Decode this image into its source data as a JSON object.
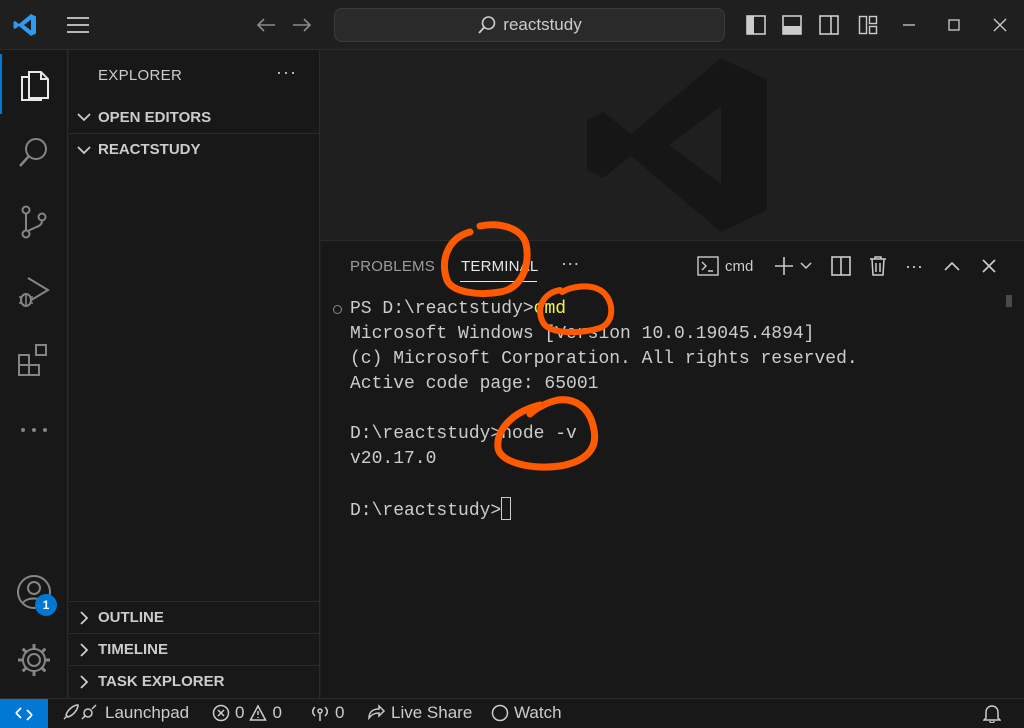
{
  "titlebar": {
    "search_text": "reactstudy"
  },
  "activity": {
    "accounts_badge": "1"
  },
  "sidebar": {
    "title": "EXPLORER",
    "more": "···",
    "sections": [
      {
        "label": "OPEN EDITORS",
        "expanded": true
      },
      {
        "label": "REACTSTUDY",
        "expanded": true
      },
      {
        "label": "OUTLINE",
        "expanded": false
      },
      {
        "label": "TIMELINE",
        "expanded": false
      },
      {
        "label": "TASK EXPLORER",
        "expanded": false
      }
    ]
  },
  "panel": {
    "tabs": [
      {
        "label": "PROBLEMS",
        "active": false
      },
      {
        "label": "TERMINAL",
        "active": true
      }
    ],
    "tabs_more": "···",
    "terminal_name": "cmd",
    "more": "···",
    "terminal": {
      "prompt_ps": "PS D:\\reactstudy>",
      "typed_cmd": "cmd",
      "line_2": "Microsoft Windows [Version 10.0.19045.4894]",
      "line_3": "(c) Microsoft Corporation. All rights reserved.",
      "line_4": "Active code page: 65001",
      "prompt_2": "D:\\reactstudy>",
      "typed_node": "node -v",
      "line_7": "v20.17.0",
      "prompt_3": "D:\\reactstudy>"
    }
  },
  "statusbar": {
    "launchpad": "Launchpad",
    "errors": "0",
    "warnings": "0",
    "ports": "0",
    "live_share": "Live Share",
    "watch": "Watch"
  },
  "colors": {
    "accent": "#0078d4",
    "annotation": "#ff5a00",
    "highlight_text": "#f5f543"
  }
}
